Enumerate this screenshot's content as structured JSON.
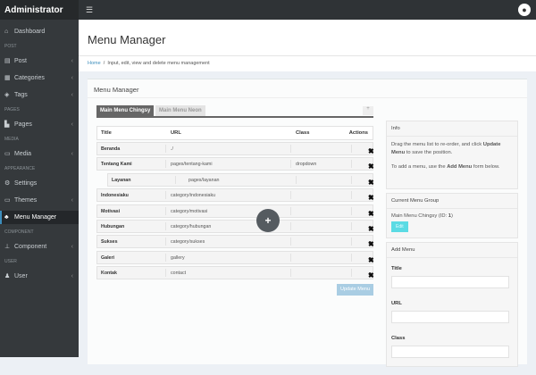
{
  "brand": "Administrator",
  "sidebar": {
    "items": [
      {
        "type": "item",
        "label": "Dashboard",
        "icon": "home-icon",
        "g": "⌂"
      },
      {
        "type": "section",
        "label": "POST"
      },
      {
        "type": "item",
        "label": "Post",
        "icon": "file-icon",
        "g": "▤",
        "chev": true
      },
      {
        "type": "item",
        "label": "Categories",
        "icon": "list-icon",
        "g": "▦",
        "chev": true
      },
      {
        "type": "item",
        "label": "Tags",
        "icon": "tags-icon",
        "g": "◈",
        "chev": true
      },
      {
        "type": "section",
        "label": "PAGES"
      },
      {
        "type": "item",
        "label": "Pages",
        "icon": "page-icon",
        "g": "▙",
        "chev": true
      },
      {
        "type": "section",
        "label": "MEDIA"
      },
      {
        "type": "item",
        "label": "Media",
        "icon": "image-icon",
        "g": "▭",
        "chev": true
      },
      {
        "type": "section",
        "label": "APPEARANCE"
      },
      {
        "type": "item",
        "label": "Settings",
        "icon": "gears-icon",
        "g": "⚙"
      },
      {
        "type": "item",
        "label": "Themes",
        "icon": "monitor-icon",
        "g": "▭",
        "chev": true
      },
      {
        "type": "item",
        "label": "Menu Manager",
        "icon": "sitemap-icon",
        "g": "♣",
        "active": true
      },
      {
        "type": "section",
        "label": "COMPONENT"
      },
      {
        "type": "item",
        "label": "Component",
        "icon": "plug-icon",
        "g": "⊥",
        "chev": true
      },
      {
        "type": "section",
        "label": "USER"
      },
      {
        "type": "item",
        "label": "User",
        "icon": "users-icon",
        "g": "♟",
        "chev": true
      }
    ]
  },
  "page_title": "Menu Manager",
  "breadcrumb": {
    "home": "Home",
    "desc": "Input, edit, view and delete menu management"
  },
  "box_title": "Menu Manager",
  "tabs": [
    "Main Menu Chingsy",
    "Main Menu Neon"
  ],
  "tab_add": "+",
  "table": {
    "headers": [
      "Title",
      "URL",
      "Class",
      "Actions"
    ],
    "rows": [
      {
        "title": "Beranda",
        "url": "./",
        "class": ""
      },
      {
        "title": "Tentang Kami",
        "url": "pages/tentang-kami",
        "class": "dropdown"
      },
      {
        "title": "Layanan",
        "url": "pages/layanan",
        "class": "",
        "child": true
      },
      {
        "title": "Indonesiaku",
        "url": "category/indonesiaku",
        "class": ""
      },
      {
        "title": "Motivasi",
        "url": "category/motivasi",
        "class": ""
      },
      {
        "title": "Hubungan",
        "url": "category/hubungan",
        "class": ""
      },
      {
        "title": "Sukses",
        "url": "category/sukses",
        "class": ""
      },
      {
        "title": "Galeri",
        "url": "gallery",
        "class": ""
      },
      {
        "title": "Kontak",
        "url": "contact",
        "class": ""
      }
    ]
  },
  "update_button": "Update Menu",
  "info": {
    "title": "Info",
    "p1a": "Drag the menu list to re-order, and click ",
    "p1b": "Update Menu",
    "p1c": " to save the position.",
    "p2a": "To add a menu, use the ",
    "p2b": "Add Menu",
    "p2c": " form below."
  },
  "group": {
    "title": "Current Menu Group",
    "name": "Main Menu Chingsy (ID: ",
    "id": "1",
    "close": ")",
    "edit": "Edit"
  },
  "add_menu": {
    "title": "Add Menu",
    "fields": [
      "Title",
      "URL",
      "Class"
    ]
  }
}
